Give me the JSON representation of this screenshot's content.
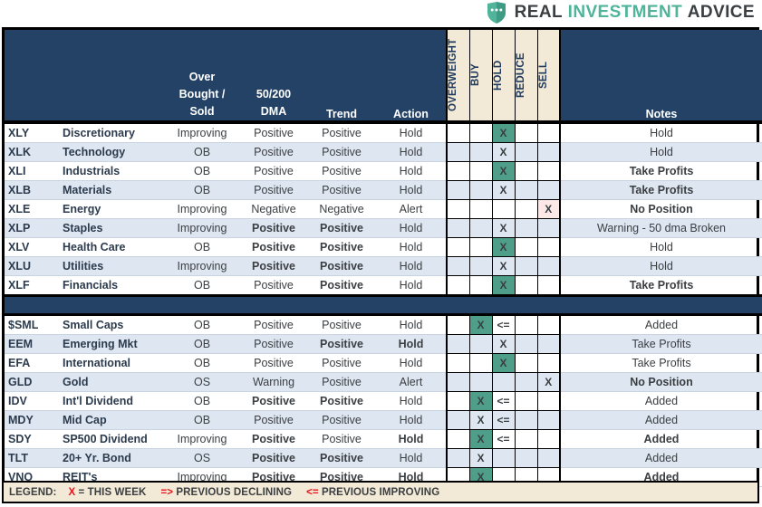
{
  "logo": {
    "icon": "shield-dots-icon",
    "word1": "REAL",
    "word2": "INVESTMENT",
    "word3": "ADVICE",
    "color_dark": "#3b3f42",
    "color_teal": "#4fb49a"
  },
  "header": {
    "col_symbol": "",
    "col_name": "",
    "col_ob_line1": "Over",
    "col_ob_line2": "Bought /",
    "col_ob_line3": "Sold",
    "col_dma_line1": "50/200",
    "col_dma_line2": "DMA",
    "col_trend": "Trend",
    "col_action": "Action",
    "col_notes": "Notes",
    "vertical": [
      "OVERWEIGHT",
      "BUY",
      "HOLD",
      "REDUCE",
      "SELL"
    ],
    "bg": "#234266",
    "vbg": "#f2e9d6"
  },
  "sections": [
    {
      "name": "sectors",
      "rows": [
        {
          "symbol": "XLY",
          "name": "Discretionary",
          "ob": "Improving",
          "dma": "Positive",
          "trend": "Positive",
          "action": "Hold",
          "signals": [
            "",
            "",
            "X",
            "",
            ""
          ],
          "signal_style": [
            "",
            "",
            "x-green",
            "",
            ""
          ],
          "notes": "Hold",
          "notes_style": "normal",
          "dma_style": "normal",
          "trend_style": "normal",
          "action_style": "normal"
        },
        {
          "symbol": "XLK",
          "name": "Technology",
          "ob": "OB",
          "dma": "Positive",
          "trend": "Positive",
          "action": "Hold",
          "signals": [
            "",
            "",
            "X",
            "",
            ""
          ],
          "signal_style": [
            "",
            "",
            "x-green",
            "",
            ""
          ],
          "notes": "Hold",
          "notes_style": "normal",
          "dma_style": "normal",
          "trend_style": "normal",
          "action_style": "normal"
        },
        {
          "symbol": "XLI",
          "name": "Industrials",
          "ob": "OB",
          "dma": "Positive",
          "trend": "Positive",
          "action": "Hold",
          "signals": [
            "",
            "",
            "X",
            "",
            ""
          ],
          "signal_style": [
            "",
            "",
            "x-green",
            "",
            ""
          ],
          "notes": "Take Profits",
          "notes_style": "bold",
          "dma_style": "normal",
          "trend_style": "normal",
          "action_style": "normal"
        },
        {
          "symbol": "XLB",
          "name": "Materials",
          "ob": "OB",
          "dma": "Positive",
          "trend": "Positive",
          "action": "Hold",
          "signals": [
            "",
            "",
            "X",
            "",
            ""
          ],
          "signal_style": [
            "",
            "",
            "x-green",
            "",
            ""
          ],
          "notes": "Take Profits",
          "notes_style": "bold",
          "dma_style": "normal",
          "trend_style": "normal",
          "action_style": "normal"
        },
        {
          "symbol": "XLE",
          "name": "Energy",
          "ob": "Improving",
          "dma": "Negative",
          "trend": "Negative",
          "action": "Alert",
          "signals": [
            "",
            "",
            "",
            "",
            "X"
          ],
          "signal_style": [
            "",
            "",
            "",
            "",
            "x-red"
          ],
          "notes": "No Position",
          "notes_style": "redbold",
          "dma_style": "red",
          "trend_style": "red",
          "action_style": "red"
        },
        {
          "symbol": "XLP",
          "name": "Staples",
          "ob": "Improving",
          "dma": "Positive",
          "trend": "Positive",
          "action": "Hold",
          "signals": [
            "",
            "",
            "X",
            "",
            ""
          ],
          "signal_style": [
            "",
            "",
            "x-green",
            "",
            ""
          ],
          "notes": "Warning - 50 dma Broken",
          "notes_style": "normal",
          "dma_style": "bold",
          "trend_style": "bold",
          "action_style": "normal"
        },
        {
          "symbol": "XLV",
          "name": "Health Care",
          "ob": "OB",
          "dma": "Positive",
          "trend": "Positive",
          "action": "Hold",
          "signals": [
            "",
            "",
            "X",
            "",
            ""
          ],
          "signal_style": [
            "",
            "",
            "x-green",
            "",
            ""
          ],
          "notes": "Hold",
          "notes_style": "normal",
          "dma_style": "bold",
          "trend_style": "bold",
          "action_style": "normal"
        },
        {
          "symbol": "XLU",
          "name": "Utilities",
          "ob": "Improving",
          "dma": "Positive",
          "trend": "Positive",
          "action": "Hold",
          "signals": [
            "",
            "",
            "X",
            "",
            ""
          ],
          "signal_style": [
            "",
            "",
            "x-green",
            "",
            ""
          ],
          "notes": "Hold",
          "notes_style": "normal",
          "dma_style": "bold",
          "trend_style": "bold",
          "action_style": "normal"
        },
        {
          "symbol": "XLF",
          "name": "Financials",
          "ob": "OB",
          "dma": "Positive",
          "trend": "Positive",
          "action": "Hold",
          "signals": [
            "",
            "",
            "X",
            "",
            ""
          ],
          "signal_style": [
            "",
            "",
            "x-green",
            "",
            ""
          ],
          "notes": "Take Profits",
          "notes_style": "redbold",
          "dma_style": "normal",
          "trend_style": "bold",
          "action_style": "normal"
        }
      ]
    },
    {
      "name": "other-assets",
      "rows": [
        {
          "symbol": "$SML",
          "name": "Small Caps",
          "ob": "OB",
          "dma": "Positive",
          "trend": "Positive",
          "action": "Hold",
          "signals": [
            "",
            "X",
            "<=",
            "",
            ""
          ],
          "signal_style": [
            "",
            "x-green",
            "arrow",
            "",
            ""
          ],
          "notes": "Added",
          "notes_style": "normal",
          "dma_style": "normal",
          "trend_style": "normal",
          "action_style": "normal"
        },
        {
          "symbol": "EEM",
          "name": "Emerging Mkt",
          "ob": "OB",
          "dma": "Positive",
          "trend": "Positive",
          "action": "Hold",
          "signals": [
            "",
            "",
            "X",
            "",
            ""
          ],
          "signal_style": [
            "",
            "",
            "x-green",
            "",
            ""
          ],
          "notes": "Take Profits",
          "notes_style": "normal",
          "dma_style": "normal",
          "trend_style": "bold",
          "action_style": "bold"
        },
        {
          "symbol": "EFA",
          "name": "International",
          "ob": "OB",
          "dma": "Positive",
          "trend": "Positive",
          "action": "Hold",
          "signals": [
            "",
            "",
            "X",
            "",
            ""
          ],
          "signal_style": [
            "",
            "",
            "x-green",
            "",
            ""
          ],
          "notes": "Take Profits",
          "notes_style": "normal",
          "dma_style": "normal",
          "trend_style": "normal",
          "action_style": "normal"
        },
        {
          "symbol": "GLD",
          "name": "Gold",
          "ob": "OS",
          "dma": "Warning",
          "trend": "Positive",
          "action": "Alert",
          "signals": [
            "",
            "",
            "",
            "",
            "X"
          ],
          "signal_style": [
            "",
            "",
            "",
            "",
            "x-red"
          ],
          "notes": "No Position",
          "notes_style": "redbold",
          "dma_style": "red",
          "trend_style": "normal",
          "action_style": "red"
        },
        {
          "symbol": "IDV",
          "name": "Int'l Dividend",
          "ob": "OB",
          "dma": "Positive",
          "trend": "Positive",
          "action": "Hold",
          "signals": [
            "",
            "X",
            "<=",
            "",
            ""
          ],
          "signal_style": [
            "",
            "x-green",
            "arrow",
            "",
            ""
          ],
          "notes": "Added",
          "notes_style": "normal",
          "dma_style": "bold",
          "trend_style": "bold",
          "action_style": "normal"
        },
        {
          "symbol": "MDY",
          "name": "Mid Cap",
          "ob": "OB",
          "dma": "Positive",
          "trend": "Positive",
          "action": "Hold",
          "signals": [
            "",
            "X",
            "<=",
            "",
            ""
          ],
          "signal_style": [
            "",
            "x-green",
            "arrow",
            "",
            ""
          ],
          "notes": "Added",
          "notes_style": "normal",
          "dma_style": "normal",
          "trend_style": "normal",
          "action_style": "normal"
        },
        {
          "symbol": "SDY",
          "name": "SP500 Dividend",
          "ob": "Improving",
          "dma": "Positive",
          "trend": "Positive",
          "action": "Hold",
          "signals": [
            "",
            "X",
            "<=",
            "",
            ""
          ],
          "signal_style": [
            "",
            "x-green",
            "arrow",
            "",
            ""
          ],
          "notes": "Added",
          "notes_style": "bold",
          "dma_style": "bold",
          "trend_style": "normal",
          "action_style": "bold"
        },
        {
          "symbol": "TLT",
          "name": "20+ Yr. Bond",
          "ob": "OS",
          "dma": "Positive",
          "trend": "Positive",
          "action": "Hold",
          "signals": [
            "",
            "X",
            "",
            "",
            ""
          ],
          "signal_style": [
            "",
            "x-green",
            "",
            "",
            ""
          ],
          "notes": "Added",
          "notes_style": "normal",
          "dma_style": "bold",
          "trend_style": "bold",
          "action_style": "normal"
        },
        {
          "symbol": "VNQ",
          "name": "REIT's",
          "ob": "Improving",
          "dma": "Positive",
          "trend": "Positive",
          "action": "Hold",
          "signals": [
            "",
            "X",
            "",
            "",
            ""
          ],
          "signal_style": [
            "",
            "x-green",
            "",
            "",
            ""
          ],
          "notes": "Added",
          "notes_style": "bold",
          "dma_style": "bold",
          "trend_style": "bold",
          "action_style": "bold"
        }
      ]
    }
  ],
  "legend": {
    "label": "LEGEND:",
    "x_mark": "X",
    "x_text": "= THIS WEEK",
    "decl_mark": "=>",
    "decl_text": "PREVIOUS DECLINING",
    "impr_mark": "<=",
    "impr_text": "PREVIOUS IMPROVING",
    "bg": "#f2e9d6",
    "accent": "#e8141a"
  }
}
